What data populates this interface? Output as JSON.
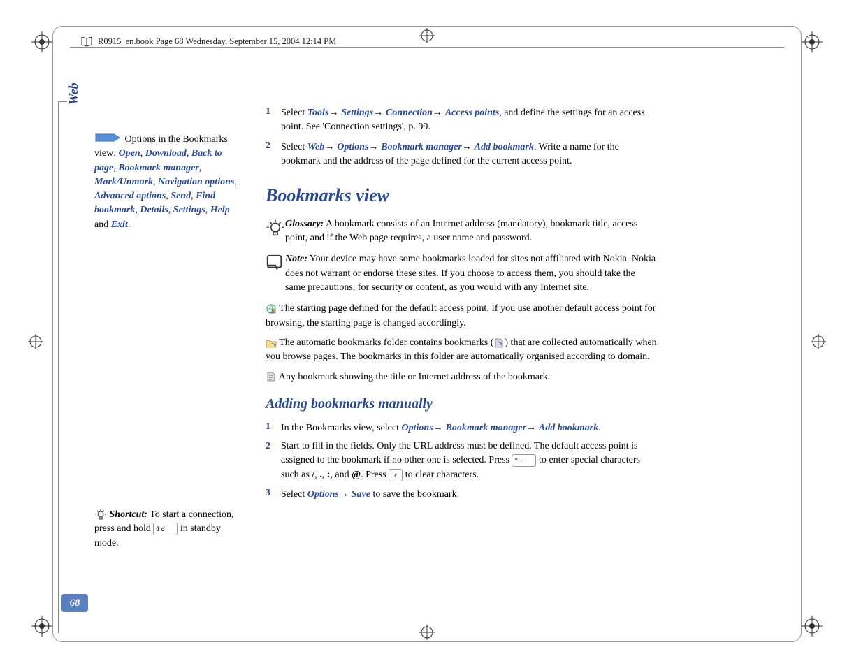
{
  "header": {
    "text": "R0915_en.book  Page 68  Wednesday, September 15, 2004  12:14 PM"
  },
  "side_tab": "Web",
  "page_number": "68",
  "sidebar": {
    "options_block": {
      "intro": " Options in the Bookmarks view: ",
      "options": [
        "Open",
        "Download",
        "Back to page",
        "Bookmark manager",
        "Mark/Unmark",
        "Navigation options",
        "Advanced options",
        "Send",
        "Find bookmark",
        "Details",
        "Settings",
        "Help"
      ],
      "last_joiner": " and ",
      "last_option": "Exit",
      "period": "."
    },
    "shortcut_block": {
      "label": " Shortcut:",
      "text_before": " To start a connection, press and hold ",
      "key": "0",
      "text_after": " in standby mode."
    }
  },
  "main": {
    "step1": {
      "num": "1",
      "pre": "Select ",
      "path": [
        "Tools",
        "Settings",
        "Connection",
        "Access points"
      ],
      "post": ", and define the settings for an access point. See 'Connection settings', p. 99."
    },
    "step2": {
      "num": "2",
      "pre": "Select ",
      "path": [
        "Web",
        "Options",
        "Bookmark manager",
        "Add bookmark"
      ],
      "post": ". Write a name for the bookmark and the address of the page defined for the current access point."
    },
    "heading1": "Bookmarks view",
    "glossary": {
      "label": "Glossary:",
      "text": " A bookmark consists of an Internet address (mandatory), bookmark title, access point, and if the Web page requires, a user name and password."
    },
    "note": {
      "label": "Note:",
      "text": " Your device may have some bookmarks loaded for sites not affiliated with Nokia. Nokia does not warrant or endorse these sites. If you choose to access them, you should take the same precautions, for security or content, as you would with any Internet site."
    },
    "para_start": " The starting page defined for the default access point. If you use another default access point for browsing, the starting page is changed accordingly.",
    "para_auto_pre": " The automatic bookmarks folder contains bookmarks (",
    "para_auto_post": ") that are collected automatically when you browse pages. The bookmarks in this folder are automatically organised according to domain.",
    "para_any": " Any bookmark showing the title or Internet address of the bookmark.",
    "heading2": "Adding bookmarks manually",
    "stepB1": {
      "num": "1",
      "pre": "In the Bookmarks view, select ",
      "path": [
        "Options",
        "Bookmark manager",
        "Add bookmark"
      ],
      "post": "."
    },
    "stepB2": {
      "num": "2",
      "text_a": "Start to fill in the fields. Only the URL address must be defined. The default access point is assigned to the bookmark if no other one is selected. Press ",
      "key1": "*    +",
      "text_b": " to enter special characters such as ",
      "chars": [
        "/",
        ".",
        ":",
        "@"
      ],
      "text_c": ". Press ",
      "key2": "c",
      "text_d": " to clear characters."
    },
    "stepB3": {
      "num": "3",
      "pre": "Select ",
      "path": [
        "Options",
        "Save"
      ],
      "post": " to save the bookmark."
    }
  },
  "arrow": "→"
}
